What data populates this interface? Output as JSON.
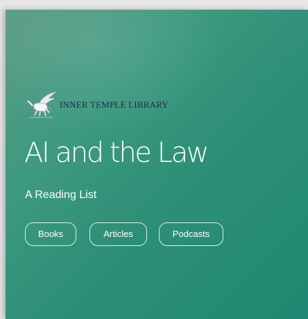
{
  "brand": {
    "logo_icon": "pegasus-icon",
    "name": "INNER TEMPLE LIBRARY"
  },
  "hero": {
    "title": "AI and the Law",
    "subtitle": "A Reading List"
  },
  "buttons": [
    {
      "label": "Books"
    },
    {
      "label": "Articles"
    },
    {
      "label": "Podcasts"
    }
  ],
  "colors": {
    "background_start": "#5a9b85",
    "background_end": "#1f8872",
    "brand_text": "#1d2a4a",
    "text": "#ffffff"
  }
}
